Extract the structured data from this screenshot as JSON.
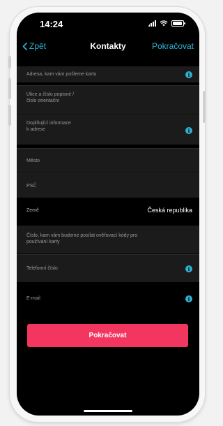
{
  "status_bar": {
    "time": "14:24"
  },
  "nav": {
    "back_label": "Zpět",
    "title": "Kontakty",
    "action_label": "Pokračovat"
  },
  "form": {
    "card_address_header": "Adresa, kam vám pošleme kartu",
    "street": "Ulice a číslo popisné /\nčíslo orientační",
    "additional_info": "Doplňující informace\nk adrese",
    "city": "Město",
    "zip": "PSČ",
    "country_label": "Země",
    "country_value": "Česká republika",
    "phone_header": "Číslo, kam vám budeme posílat ověřovací kódy pro\npoužívání karty",
    "phone": "Telefonní číslo",
    "email": "E-mail"
  },
  "cta": {
    "label": "Pokračovat"
  },
  "colors": {
    "accent": "#2bb6d6",
    "cta": "#f2365f",
    "info": "#2fb0d2"
  },
  "icons": {
    "back": "chevron-left-icon",
    "info": "info-icon"
  }
}
